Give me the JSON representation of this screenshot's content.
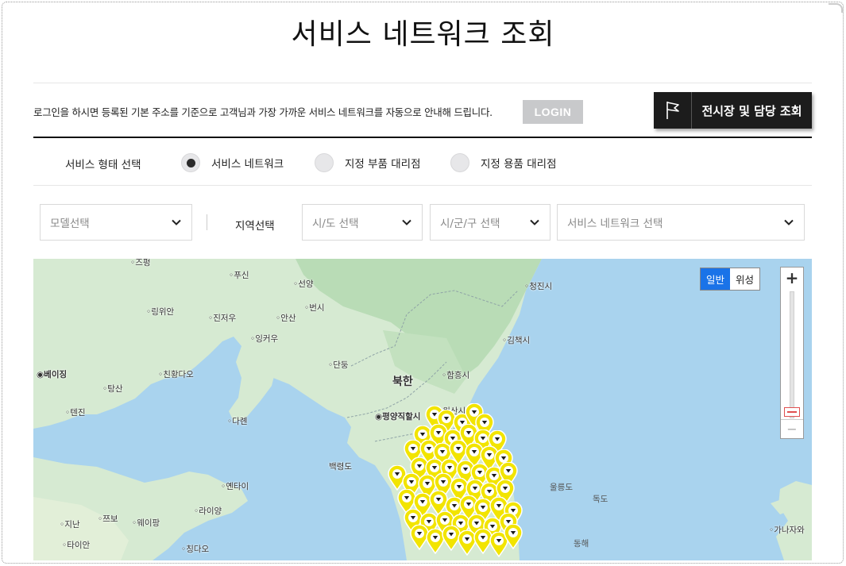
{
  "page": {
    "title": "서비스 네트워크 조회"
  },
  "login": {
    "message": "로그인을 하시면 등록된 기본 주소를 기준으로 고객님과 가장 가까운 서비스 네트워크를 자동으로 안내해 드립니다.",
    "button": "LOGIN"
  },
  "showroom": {
    "label": "전시장 및 담당 조회",
    "icon": "flag-icon"
  },
  "service_type": {
    "label": "서비스 형태 선택",
    "options": [
      {
        "label": "서비스 네트워크",
        "selected": true
      },
      {
        "label": "지정 부품 대리점",
        "selected": false
      },
      {
        "label": "지정 용품 대리점",
        "selected": false
      }
    ]
  },
  "filters": {
    "model": "모델선택",
    "region_label": "지역선택",
    "sido": "시/도 선택",
    "sigungu": "시/군/구 선택",
    "network": "서비스 네트워크 선택"
  },
  "map": {
    "type_options": [
      "일반",
      "위성"
    ],
    "selected_type": "일반",
    "zoom_in": "+",
    "zoom_out": "−",
    "places": {
      "zhengzhou": "◦즈펑",
      "fuxin": "◦푸신",
      "shenyang": "◦선양",
      "fushun": "◦번시",
      "anshan": "◦안산",
      "qingjin": "◦청진시",
      "lingyuan": "◦링위안",
      "jinzhou": "◦진저우",
      "yingkou": "◦잉커우",
      "kimchaek": "◦김책시",
      "beijing": "◉베이징",
      "qinhuangdao": "◦친황다오",
      "dandong": "◦단둥",
      "hamhung": "◦함흥시",
      "north_korea": "북한",
      "tangshan": "◦탕산",
      "tianjin": "◦텐진",
      "dalian": "◦다롄",
      "pyongyang": "◉평양직할시",
      "wonsan": "◦원산시",
      "baengnyeong": "백령도",
      "yantai": "◦옌타이",
      "ulleung": "울릉도",
      "dokdo": "독도",
      "laiyang": "◦라이양",
      "jinan": "◦지난",
      "zibo": "◦쯔보",
      "weifang": "◦웨이팡",
      "taian": "◦타이안",
      "qingdao": "◦칭다오",
      "donghae": "동해",
      "kanazawa": "◦가나자와"
    }
  }
}
